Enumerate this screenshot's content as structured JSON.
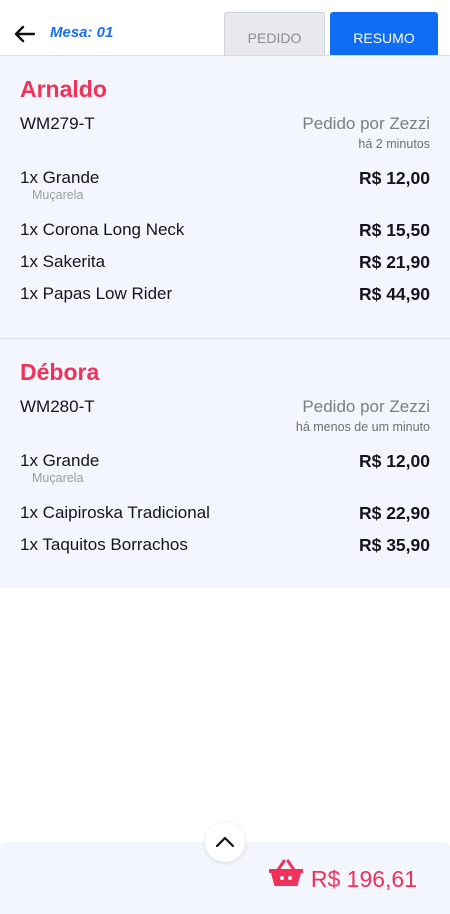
{
  "header": {
    "back_icon": "arrow-left-icon",
    "mesa_label": "Mesa: 01",
    "tabs": [
      {
        "label": "PEDIDO",
        "active": false
      },
      {
        "label": "RESUMO",
        "active": true
      }
    ],
    "accent_color": "#0f6cf5"
  },
  "orders": [
    {
      "customer": "Arnaldo",
      "code": "WM279-T",
      "ordered_by": "Pedido por Zezzi",
      "time_ago": "há 2 minutos",
      "items": [
        {
          "name": "1x Grande",
          "note": "Muçarela",
          "price": "R$ 12,00"
        },
        {
          "name": "1x Corona Long Neck",
          "price": "R$ 15,50"
        },
        {
          "name": "1x Sakerita",
          "price": "R$ 21,90"
        },
        {
          "name": "1x Papas Low Rider",
          "price": "R$ 44,90"
        }
      ]
    },
    {
      "customer": "Débora",
      "code": "WM280-T",
      "ordered_by": "Pedido por Zezzi",
      "time_ago": "há menos de um minuto",
      "items": [
        {
          "name": "1x Grande",
          "note": "Muçarela",
          "price": "R$ 12,00"
        },
        {
          "name": "1x Caipiroska Tradicional",
          "price": "R$ 22,90"
        },
        {
          "name": "1x Taquitos Borrachos",
          "price": "R$ 35,90"
        }
      ]
    }
  ],
  "footer": {
    "scroll_icon": "chevron-up-icon",
    "basket_icon": "basket-icon",
    "total": "R$ 196,61",
    "total_color": "#f0325a"
  }
}
